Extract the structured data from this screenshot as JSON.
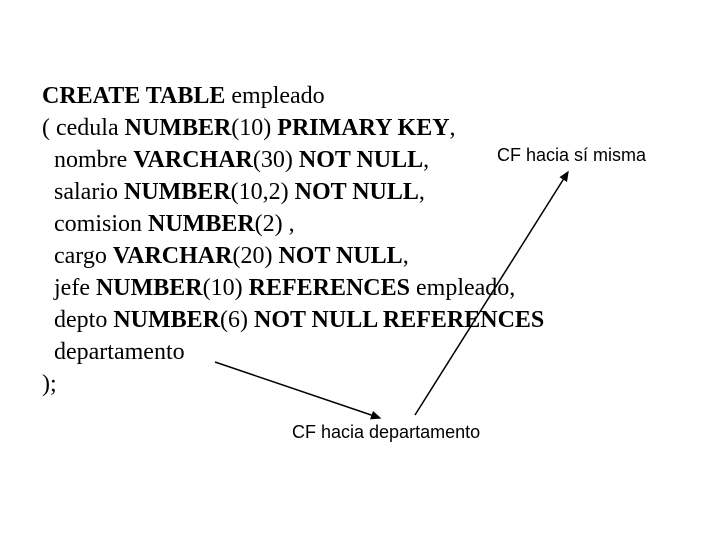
{
  "code": {
    "l1": {
      "kw1": "CREATE TABLE",
      "t1": " empleado"
    },
    "l2": {
      "t1": "( cedula ",
      "kw1": "NUMBER",
      "t2": "(10) ",
      "kw2": "PRIMARY KEY",
      "t3": ","
    },
    "l3": {
      "t1": "  nombre ",
      "kw1": "VARCHAR",
      "t2": "(30) ",
      "kw2": "NOT NULL",
      "t3": ","
    },
    "l4": {
      "t1": "  salario ",
      "kw1": "NUMBER",
      "t2": "(10,2) ",
      "kw2": "NOT NULL",
      "t3": ","
    },
    "l5": {
      "t1": "  comision ",
      "kw1": "NUMBER",
      "t2": "(2) ,"
    },
    "l6": {
      "t1": "  cargo ",
      "kw1": "VARCHAR",
      "t2": "(20) ",
      "kw2": "NOT NULL",
      "t3": ","
    },
    "l7": {
      "t1": "  jefe ",
      "kw1": "NUMBER",
      "t2": "(10) ",
      "kw2": "REFERENCES",
      "t3": " empleado,"
    },
    "l8": {
      "t1": "  depto ",
      "kw1": "NUMBER",
      "t2": "(6) ",
      "kw2": "NOT NULL REFERENCES"
    },
    "l9": {
      "t1": "  departamento"
    },
    "l10": {
      "t1": ");"
    }
  },
  "annotations": {
    "a1": "CF hacia sí misma",
    "a2": "CF hacia departamento"
  }
}
